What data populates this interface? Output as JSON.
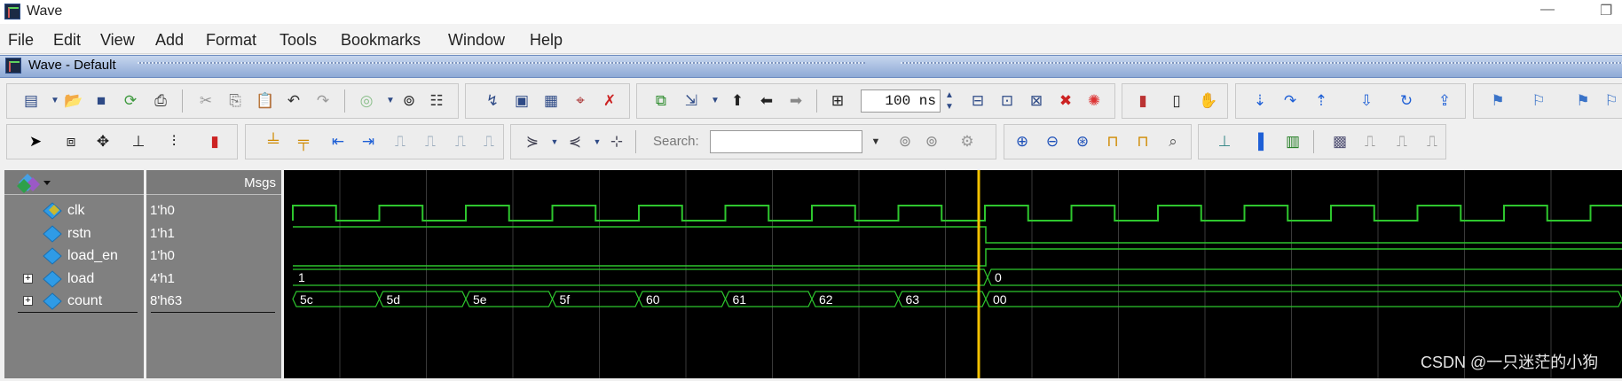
{
  "window": {
    "title": "Wave",
    "minimize_glyph": "—",
    "restore_glyph": "❐"
  },
  "menu": [
    "File",
    "Edit",
    "View",
    "Add",
    "Format",
    "Tools",
    "Bookmarks",
    "Window",
    "Help"
  ],
  "subwindow": {
    "title": "Wave - Default"
  },
  "toolbar": {
    "time_value": "100 ns",
    "search_label": "Search:",
    "search_value": ""
  },
  "columns": {
    "msgs_label": "Msgs"
  },
  "signals": [
    {
      "name": "clk",
      "value": "1'h0",
      "expandable": false,
      "kind": "clock"
    },
    {
      "name": "rstn",
      "value": "1'h1",
      "expandable": false,
      "kind": "wire"
    },
    {
      "name": "load_en",
      "value": "1'h0",
      "expandable": false,
      "kind": "wire"
    },
    {
      "name": "load",
      "value": "4'h1",
      "expandable": true,
      "kind": "bus"
    },
    {
      "name": "count",
      "value": "8'h63",
      "expandable": true,
      "kind": "bus"
    }
  ],
  "waves": {
    "load_labels": [
      "1",
      "0"
    ],
    "count_labels": [
      "5c",
      "5d",
      "5e",
      "5f",
      "60",
      "61",
      "62",
      "63",
      "00"
    ]
  },
  "colors": {
    "wave": "#2ec62e",
    "cursor": "#f2c100",
    "grid": "#3a3a3a",
    "bus_text": "#ffffff"
  },
  "watermark": "CSDN @一只迷茫的小狗"
}
